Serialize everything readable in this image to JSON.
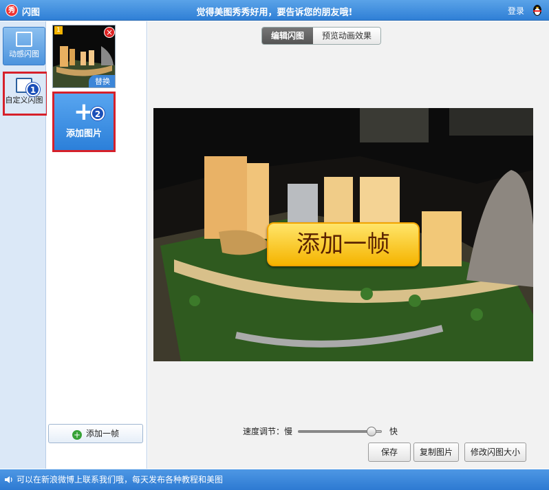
{
  "titlebar": {
    "logo_text": "秀",
    "title": "闪图",
    "slogan": "觉得美图秀秀好用，要告诉您的朋友哦!",
    "login_label": "登录"
  },
  "mode_rail": {
    "items": [
      {
        "label": "动感闪图",
        "active": true
      },
      {
        "label": "自定义闪图",
        "active": false
      }
    ],
    "badges": [
      "1",
      "2"
    ]
  },
  "frame_panel": {
    "frames": [
      {
        "number": "1",
        "replace_label": "替换",
        "close_label": "×"
      }
    ],
    "add_picture": {
      "plus": "+",
      "label": "添加图片"
    },
    "add_frame_button": {
      "icon": "+",
      "label": "添加一帧"
    }
  },
  "main": {
    "tabs": [
      {
        "label": "编辑闪图",
        "active": true
      },
      {
        "label": "预览动画效果",
        "active": false
      }
    ],
    "stage_label": "添加一帧",
    "speed": {
      "label": "速度调节：慢",
      "fast_label": "快",
      "level": 0.88
    },
    "buttons": {
      "save": "保存",
      "copy": "复制图片",
      "resize": "修改闪图大小"
    }
  },
  "statusbar": {
    "text": "可以在新浪微博上联系我们哦，每天发布各种教程和美图"
  },
  "colors": {
    "accent": "#2f7fd6",
    "highlight": "#d6202a",
    "badge": "#1b4fb8"
  }
}
